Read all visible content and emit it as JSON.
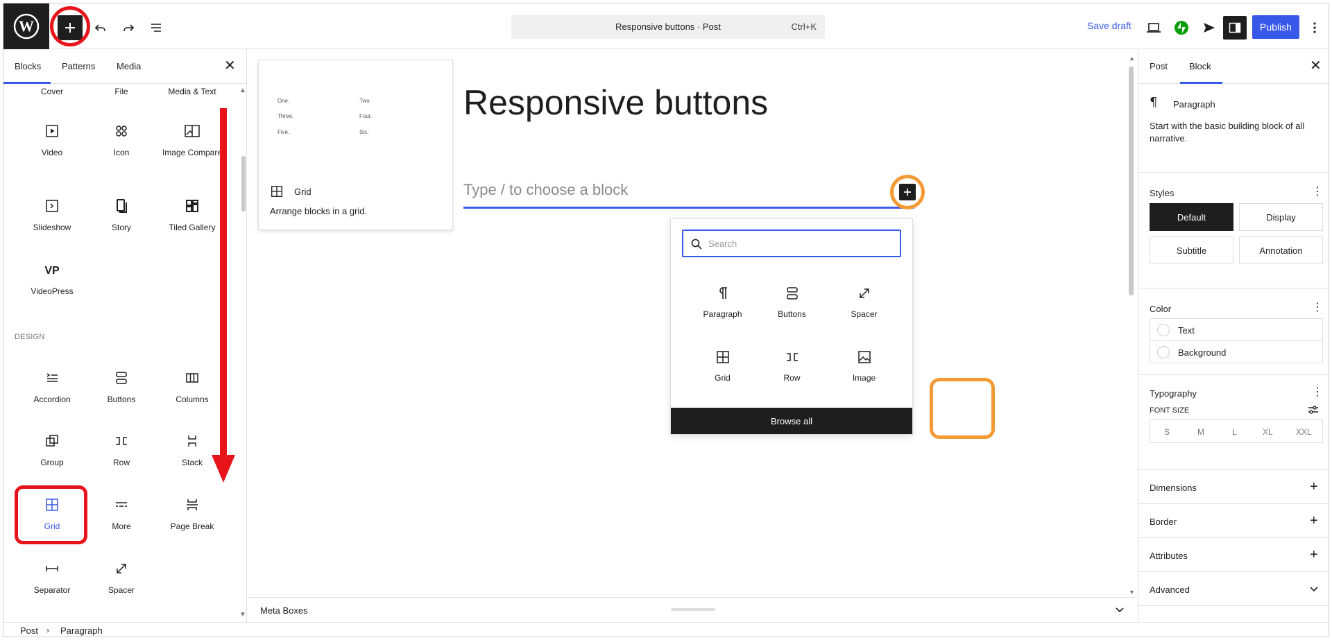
{
  "topbar": {
    "document_title": "Responsive buttons · Post",
    "shortcut": "Ctrl+K",
    "save_draft": "Save draft",
    "publish": "Publish"
  },
  "left_panel": {
    "tabs": [
      "Blocks",
      "Patterns",
      "Media"
    ],
    "top_row": [
      "Cover",
      "File",
      "Media & Text"
    ],
    "media_blocks": [
      {
        "label": "Video",
        "icon": "video-icon"
      },
      {
        "label": "Icon",
        "icon": "icon-block-icon"
      },
      {
        "label": "Image Compare",
        "icon": "image-compare-icon"
      },
      {
        "label": "Slideshow",
        "icon": "slideshow-icon"
      },
      {
        "label": "Story",
        "icon": "story-icon"
      },
      {
        "label": "Tiled Gallery",
        "icon": "tiled-gallery-icon"
      },
      {
        "label": "VideoPress",
        "icon": "videopress-icon"
      }
    ],
    "design_heading": "DESIGN",
    "design_blocks": [
      {
        "label": "Accordion",
        "icon": "accordion-icon"
      },
      {
        "label": "Buttons",
        "icon": "buttons-icon"
      },
      {
        "label": "Columns",
        "icon": "columns-icon"
      },
      {
        "label": "Group",
        "icon": "group-icon"
      },
      {
        "label": "Row",
        "icon": "row-icon"
      },
      {
        "label": "Stack",
        "icon": "stack-icon"
      },
      {
        "label": "Grid",
        "icon": "grid-icon"
      },
      {
        "label": "More",
        "icon": "more-icon"
      },
      {
        "label": "Page Break",
        "icon": "page-break-icon"
      },
      {
        "label": "Separator",
        "icon": "separator-icon"
      },
      {
        "label": "Spacer",
        "icon": "spacer-icon"
      }
    ]
  },
  "preview": {
    "cells": [
      "One.",
      "Two.",
      "Three.",
      "Four.",
      "Five.",
      "Six."
    ],
    "name": "Grid",
    "description": "Arrange blocks in a grid."
  },
  "canvas": {
    "post_title": "Responsive buttons",
    "placeholder": "Type / to choose a block",
    "meta_boxes": "Meta Boxes"
  },
  "inserter": {
    "search_placeholder": "Search",
    "items": [
      {
        "label": "Paragraph",
        "icon": "paragraph-icon"
      },
      {
        "label": "Buttons",
        "icon": "buttons-icon"
      },
      {
        "label": "Spacer",
        "icon": "spacer-icon"
      },
      {
        "label": "Grid",
        "icon": "grid-icon"
      },
      {
        "label": "Row",
        "icon": "row-icon"
      },
      {
        "label": "Image",
        "icon": "image-icon"
      }
    ],
    "browse_all": "Browse all"
  },
  "right_panel": {
    "tabs": [
      "Post",
      "Block"
    ],
    "block_name": "Paragraph",
    "block_description": "Start with the basic building block of all narrative.",
    "styles_heading": "Styles",
    "styles": [
      "Default",
      "Display",
      "Subtitle",
      "Annotation"
    ],
    "color_heading": "Color",
    "colors": [
      "Text",
      "Background"
    ],
    "typography_heading": "Typography",
    "font_size_label": "FONT SIZE",
    "font_sizes": [
      "S",
      "M",
      "L",
      "XL",
      "XXL"
    ],
    "panels": [
      "Dimensions",
      "Border",
      "Attributes",
      "Advanced"
    ]
  },
  "footer": {
    "breadcrumb": [
      "Post",
      "Paragraph"
    ]
  },
  "colors": {
    "accent": "#3858e9",
    "annotation_red": "#e8141b",
    "annotation_orange": "#f39a34",
    "dark": "#1e1e1e"
  }
}
